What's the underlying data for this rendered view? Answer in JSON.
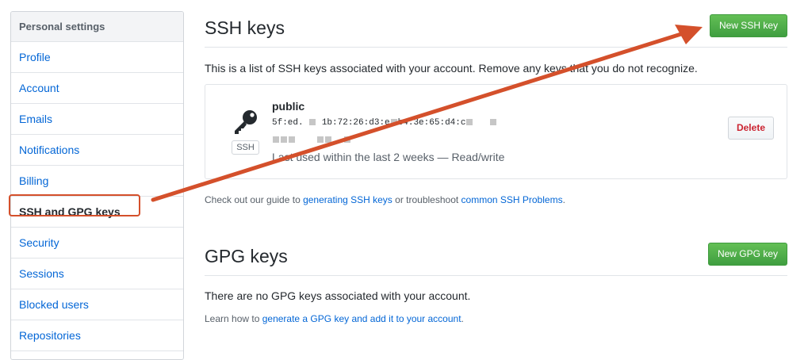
{
  "sidebar": {
    "header": "Personal settings",
    "items": [
      {
        "label": "Profile"
      },
      {
        "label": "Account"
      },
      {
        "label": "Emails"
      },
      {
        "label": "Notifications"
      },
      {
        "label": "Billing"
      },
      {
        "label": "SSH and GPG keys",
        "selected": true
      },
      {
        "label": "Security"
      },
      {
        "label": "Sessions"
      },
      {
        "label": "Blocked users"
      },
      {
        "label": "Repositories"
      }
    ]
  },
  "ssh": {
    "title": "SSH keys",
    "new_button": "New SSH key",
    "description": "This is a list of SSH keys associated with your account. Remove any keys that you do not recognize.",
    "key": {
      "title": "public",
      "fingerprint_start": "5f:ed.",
      "fingerprint_mid": "1b:72:26:d3:e",
      "fingerprint_end": "b4:3e:65:d4:c",
      "type_badge": "SSH",
      "last_used": "Last used within the last 2 weeks — Read/write",
      "delete_button": "Delete"
    },
    "guide_prefix": "Check out our guide to ",
    "guide_link1": "generating SSH keys",
    "guide_middle": " or troubleshoot ",
    "guide_link2": "common SSH Problems",
    "guide_suffix": "."
  },
  "gpg": {
    "title": "GPG keys",
    "new_button": "New GPG key",
    "empty_text": "There are no GPG keys associated with your account.",
    "learn_prefix": "Learn how to ",
    "learn_link": "generate a GPG key and add it to your account",
    "learn_suffix": "."
  },
  "colors": {
    "annotation": "#d4502b",
    "link": "#0366d6",
    "button_green": "#4caf50",
    "danger": "#cb2431"
  },
  "icons": {
    "key": "key-icon"
  }
}
